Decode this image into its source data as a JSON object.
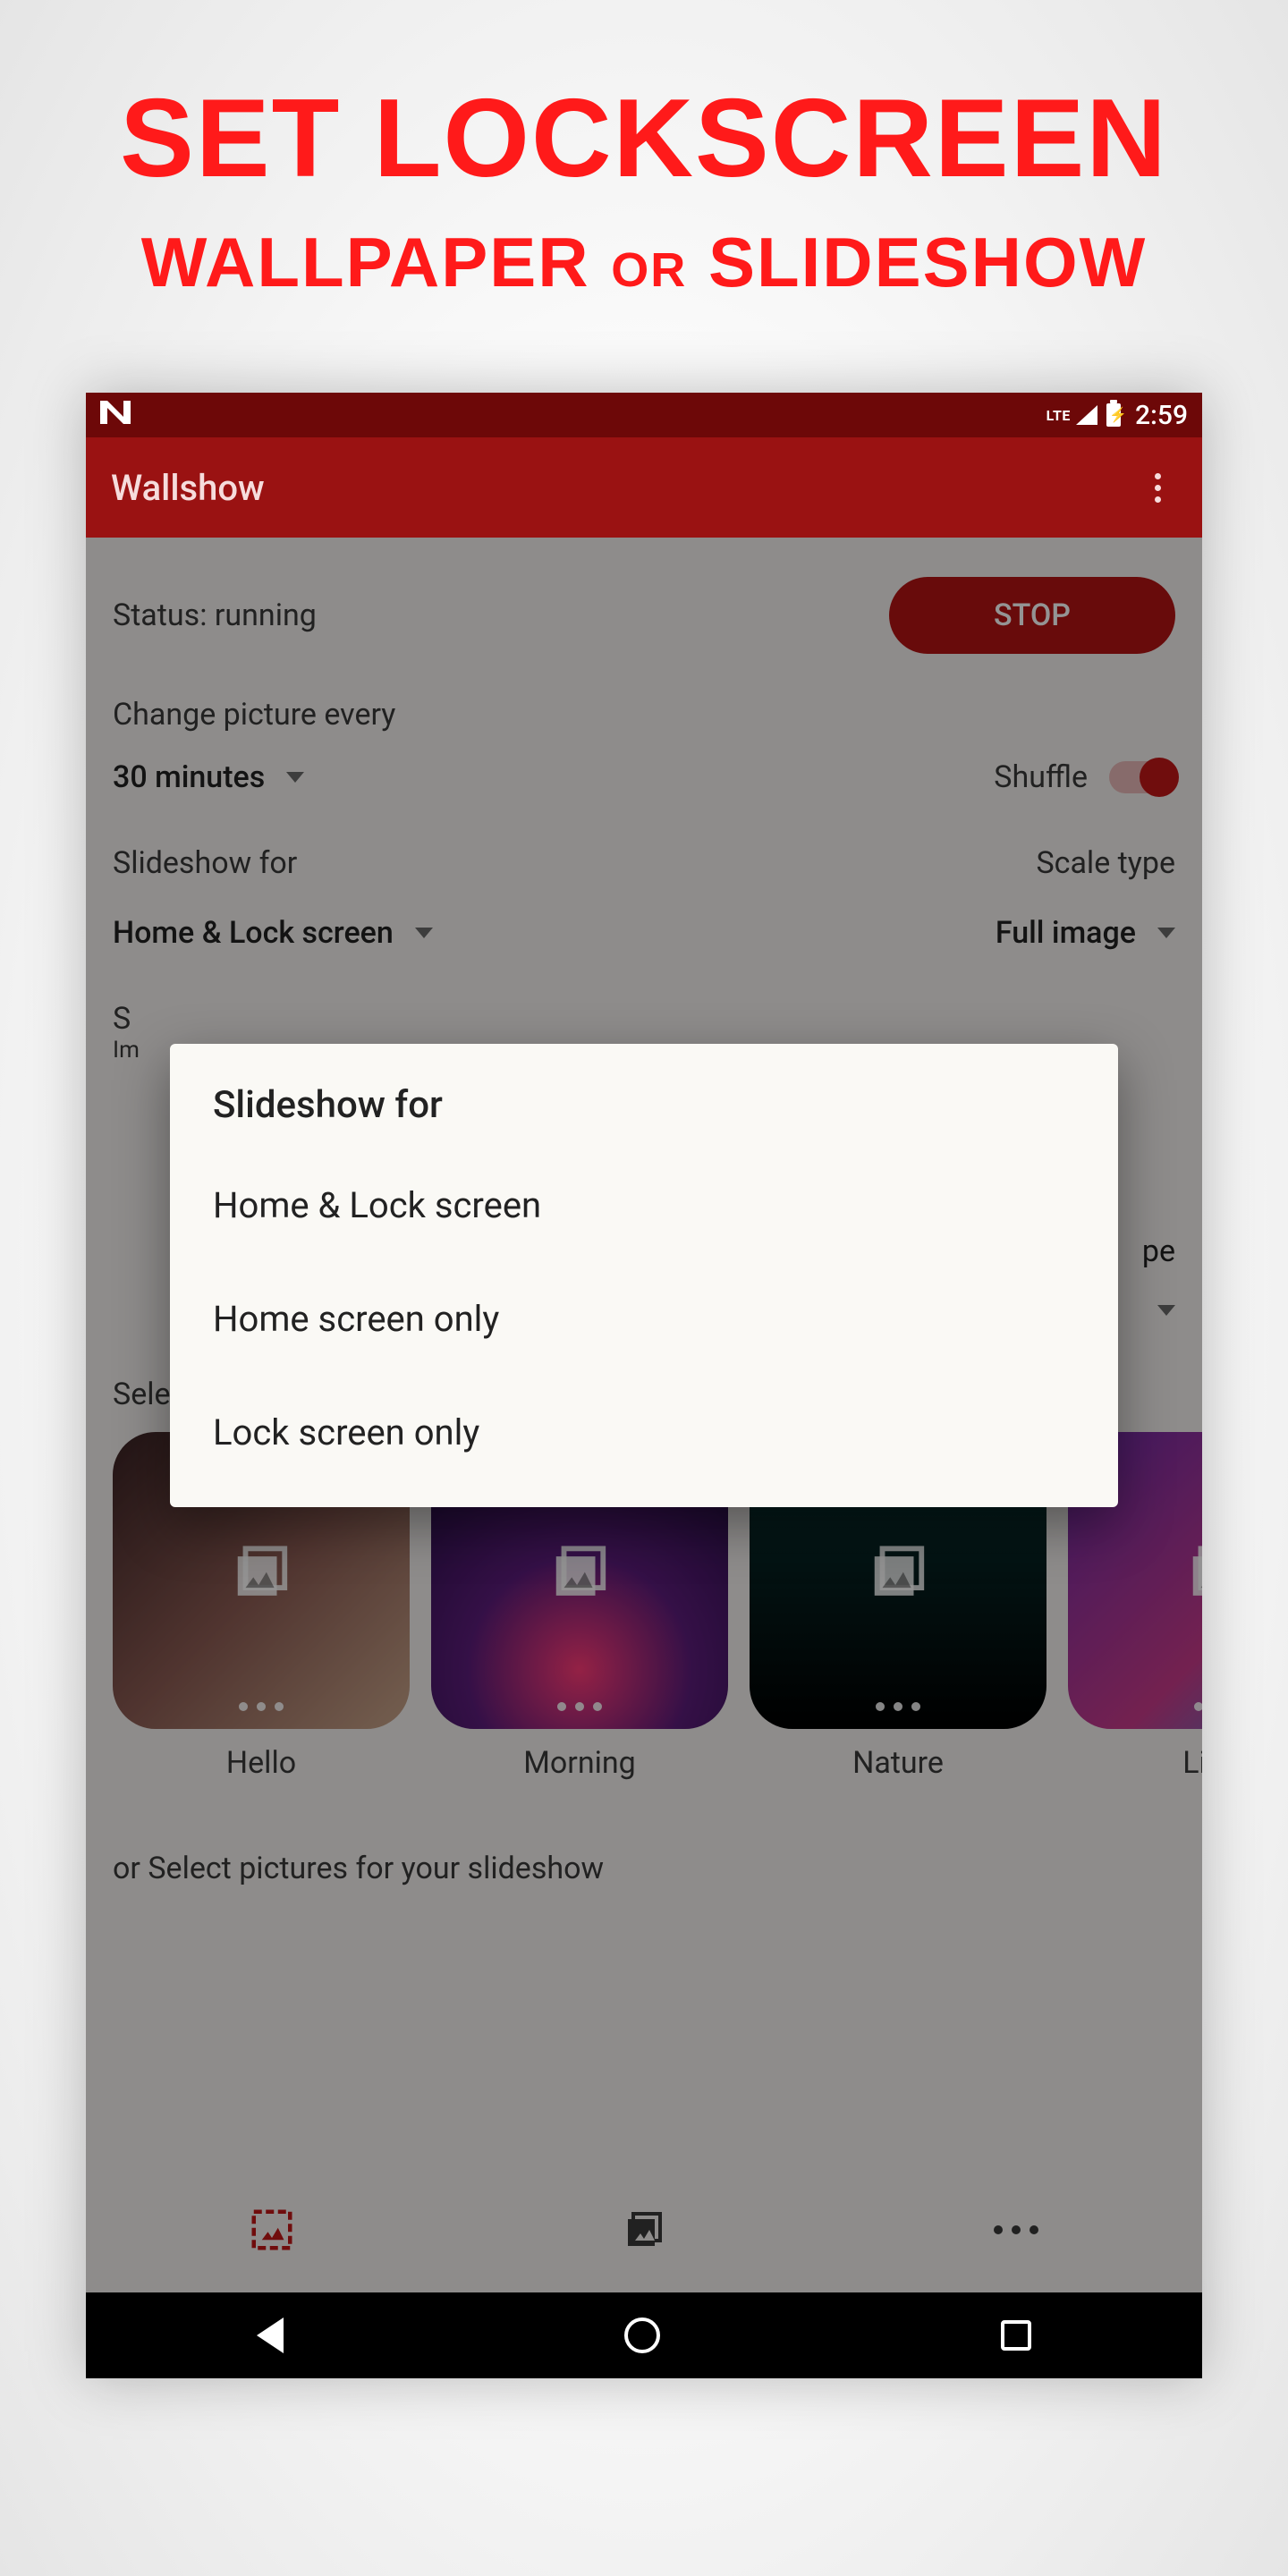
{
  "promo": {
    "title": "SET LOCKSCREEN",
    "sub_wallpaper": "WALLPAPER",
    "sub_or": "OR",
    "sub_slideshow": "SLIDESHOW"
  },
  "status_bar": {
    "network": "LTE",
    "time": "2:59"
  },
  "app_bar": {
    "title": "Wallshow"
  },
  "main": {
    "status_label": "Status: running",
    "stop": "STOP",
    "change_label": "Change picture every",
    "interval": "30 minutes",
    "shuffle_label": "Shuffle",
    "slideshow_for_label": "Slideshow for",
    "scale_type_label": "Scale type",
    "slideshow_for_value": "Home & Lock screen",
    "scale_type_value": "Full image",
    "peek_s": "S",
    "peek_i": "Im",
    "peek_pe": "pe",
    "select_folders_label": "Select folders for your slideshow",
    "or_select_label": "or Select pictures for your slideshow"
  },
  "folders": [
    {
      "name": "Hello",
      "cls": "hello"
    },
    {
      "name": "Morning",
      "cls": "morning"
    },
    {
      "name": "Nature",
      "cls": "nature"
    },
    {
      "name": "Light",
      "cls": "light"
    }
  ],
  "dialog": {
    "title": "Slideshow for",
    "options": [
      "Home & Lock screen",
      "Home screen only",
      "Lock screen only"
    ]
  }
}
